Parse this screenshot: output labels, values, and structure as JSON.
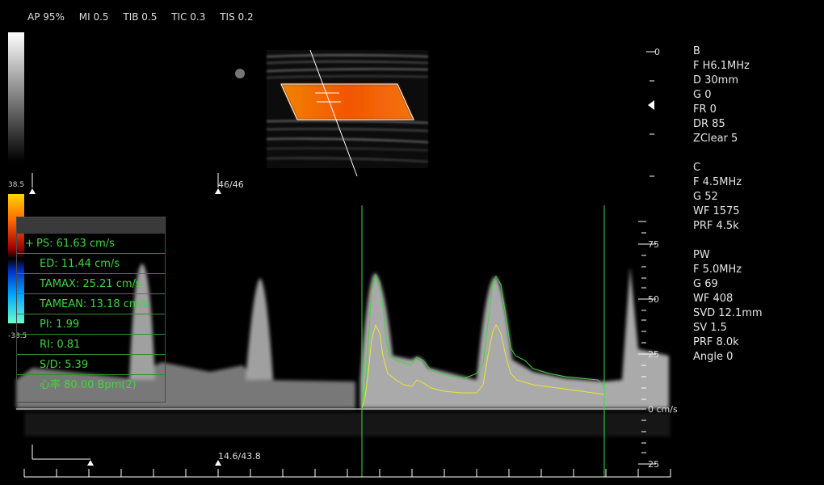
{
  "top_info": {
    "ap": "AP 95%",
    "mi": "MI 0.5",
    "tib": "TIB 0.5",
    "tic": "TIC 0.3",
    "tis": "TIS 0.2"
  },
  "params": {
    "b": [
      "B",
      "F H6.1MHz",
      "D 30mm",
      "G 0",
      "FR 0",
      "DR 85",
      "ZClear 5"
    ],
    "c": [
      "C",
      "F 4.5MHz",
      "G 52",
      "WF 1575",
      "PRF 4.5k"
    ],
    "pw": [
      "PW",
      "F 5.0MHz",
      "G 69",
      "WF 408",
      "SVD 12.1mm",
      "SV 1.5",
      "PRF 8.0k",
      "Angle 0"
    ]
  },
  "color_scale": {
    "max": "38.5",
    "min": "-38.5"
  },
  "depth_scale": {
    "zero": "0"
  },
  "frame_counter": "46/46",
  "sweep_time": "14.6/43.8",
  "velocity_scale": {
    "labels": [
      "75",
      "50",
      "25",
      "0 cm/s",
      "25"
    ]
  },
  "measurements": {
    "cursor": "+",
    "ps": "PS: 61.63 cm/s",
    "ed": "ED: 11.44 cm/s",
    "tamax": "TAMAX: 25.21 cm/s",
    "tamean": "TAMEAN: 13.18 cm/s",
    "pi": "PI: 1.99",
    "ri": "RI: 0.81",
    "sd": "S/D: 5.39",
    "hr": "心率 80.00 Bpm(2)"
  },
  "colors": {
    "trace_max": "#3fd63f",
    "trace_mean": "#e8e83a",
    "measure_text": "#3fd63f",
    "color_box": "#ff6a00"
  }
}
